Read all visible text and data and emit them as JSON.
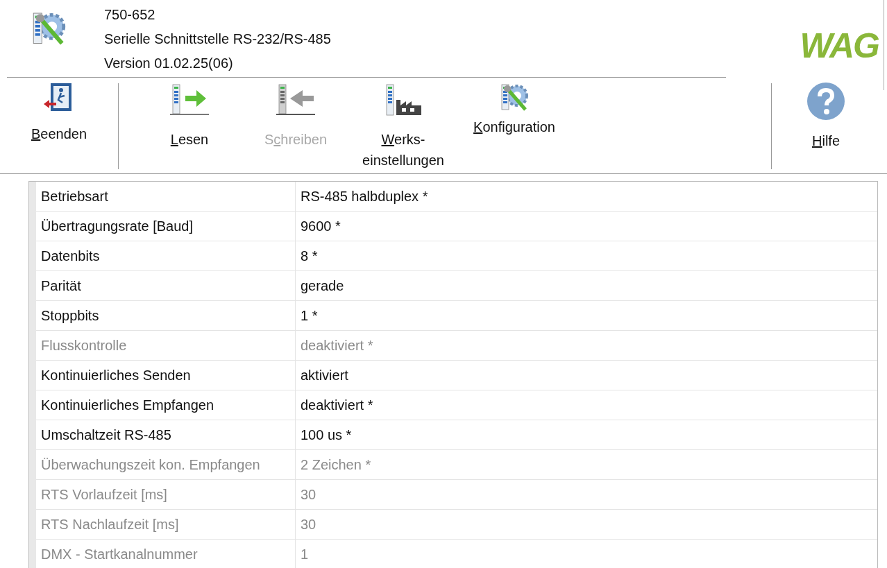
{
  "header": {
    "lines": [
      "750-652",
      "Serielle Schnittstelle RS-232/RS-485",
      "Version 01.02.25(06)"
    ],
    "logo": "WAG"
  },
  "toolbar": {
    "left": [
      {
        "kind": "exit",
        "key": "B",
        "after": "eenden",
        "disabled": false
      }
    ],
    "main": [
      {
        "kind": "read",
        "key": "L",
        "after": "esen",
        "disabled": false
      },
      {
        "kind": "write",
        "before": "S",
        "key": "c",
        "after": "hreiben",
        "disabled": true
      },
      {
        "kind": "factory",
        "key": "W",
        "after": "erks-einstellungen",
        "disabled": false
      },
      {
        "kind": "config",
        "key": "K",
        "after": "onfiguration",
        "disabled": false
      }
    ],
    "right": [
      {
        "kind": "help",
        "key": "H",
        "after": "ilfe",
        "disabled": false
      }
    ]
  },
  "parameters": [
    {
      "name": "Betriebsart",
      "value": "RS-485 halbduplex *",
      "disabled": false
    },
    {
      "name": "Übertragungsrate [Baud]",
      "value": "9600 *",
      "disabled": false
    },
    {
      "name": "Datenbits",
      "value": "8 *",
      "disabled": false
    },
    {
      "name": "Parität",
      "value": "gerade",
      "disabled": false
    },
    {
      "name": "Stoppbits",
      "value": "1 *",
      "disabled": false
    },
    {
      "name": "Flusskontrolle",
      "value": "deaktiviert *",
      "disabled": true
    },
    {
      "name": "Kontinuierliches Senden",
      "value": "aktiviert",
      "disabled": false
    },
    {
      "name": "Kontinuierliches Empfangen",
      "value": "deaktiviert *",
      "disabled": false
    },
    {
      "name": "Umschaltzeit RS-485",
      "value": "100 us *",
      "disabled": false
    },
    {
      "name": "Überwachungszeit kon. Empfangen",
      "value": "2 Zeichen *",
      "disabled": true
    },
    {
      "name": "RTS Vorlaufzeit [ms]",
      "value": "30",
      "disabled": true
    },
    {
      "name": "RTS Nachlaufzeit [ms]",
      "value": "30",
      "disabled": true
    },
    {
      "name": "DMX - Startkanalnummer",
      "value": "1",
      "disabled": true
    }
  ]
}
